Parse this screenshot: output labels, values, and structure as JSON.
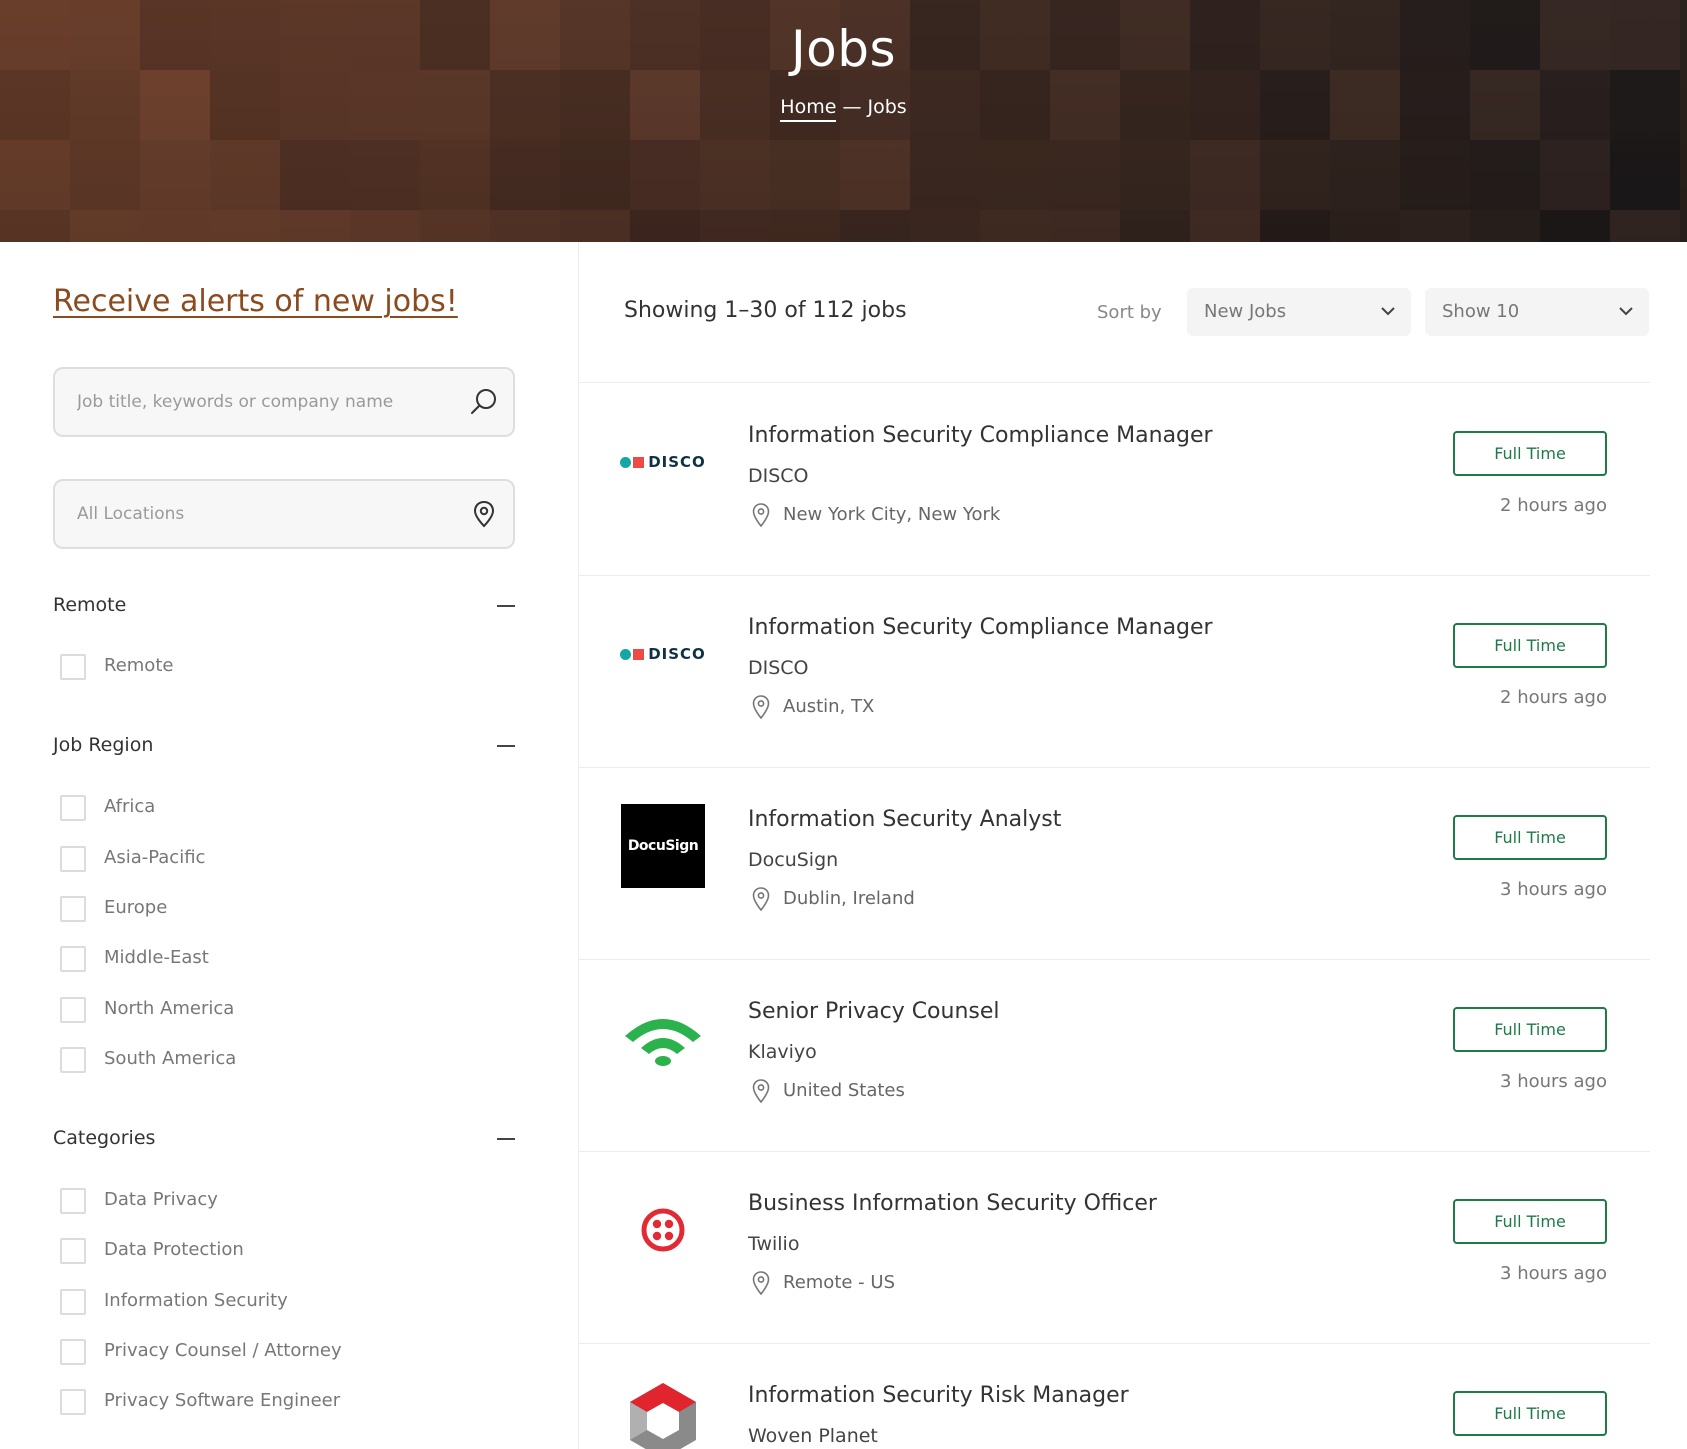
{
  "hero": {
    "title": "Jobs",
    "breadcrumb_home": "Home",
    "breadcrumb_separator": "—",
    "breadcrumb_current": "Jobs"
  },
  "sidebar": {
    "alert_link": "Receive alerts of new jobs!",
    "search_placeholder": "Job title, keywords or company name",
    "location_placeholder": "All Locations",
    "groups": [
      {
        "title": "Remote",
        "options": [
          "Remote"
        ]
      },
      {
        "title": "Job Region",
        "options": [
          "Africa",
          "Asia-Pacific",
          "Europe",
          "Middle-East",
          "North America",
          "South America"
        ]
      },
      {
        "title": "Categories",
        "options": [
          "Data Privacy",
          "Data Protection",
          "Information Security",
          "Privacy Counsel / Attorney",
          "Privacy Software Engineer"
        ]
      }
    ]
  },
  "listing": {
    "showing": "Showing 1–30 of 112 jobs",
    "sort_label": "Sort by",
    "sort_value": "New Jobs",
    "show_value": "Show 10"
  },
  "jobs": [
    {
      "title": "Information Security Compliance Manager",
      "company": "DISCO",
      "location": "New York City, New York",
      "type": "Full Time",
      "posted": "2 hours ago",
      "logo": "disco-logo",
      "logo_text": "DISCO"
    },
    {
      "title": "Information Security Compliance Manager",
      "company": "DISCO",
      "location": "Austin, TX",
      "type": "Full Time",
      "posted": "2 hours ago",
      "logo": "disco-logo",
      "logo_text": "DISCO"
    },
    {
      "title": "Information Security Analyst",
      "company": "DocuSign",
      "location": "Dublin, Ireland",
      "type": "Full Time",
      "posted": "3 hours ago",
      "logo": "docusign-logo",
      "logo_text": "DocuSign"
    },
    {
      "title": "Senior Privacy Counsel",
      "company": "Klaviyo",
      "location": "United States",
      "type": "Full Time",
      "posted": "3 hours ago",
      "logo": "klaviyo-logo",
      "logo_text": ""
    },
    {
      "title": "Business Information Security Officer",
      "company": "Twilio",
      "location": "Remote - US",
      "type": "Full Time",
      "posted": "3 hours ago",
      "logo": "twilio-logo",
      "logo_text": ""
    },
    {
      "title": "Information Security Risk Manager",
      "company": "Woven Planet",
      "location": "",
      "type": "Full Time",
      "posted": "",
      "logo": "woven-planet-logo",
      "logo_text": ""
    }
  ],
  "colors": {
    "accent_link": "#8a4b1f",
    "badge_green": "#1e7a46",
    "disco_teal": "#14a7a3",
    "disco_red": "#ee4a46",
    "klaviyo_green": "#2bb24c",
    "twilio_red": "#e22a35",
    "woven_red": "#e1252f"
  }
}
